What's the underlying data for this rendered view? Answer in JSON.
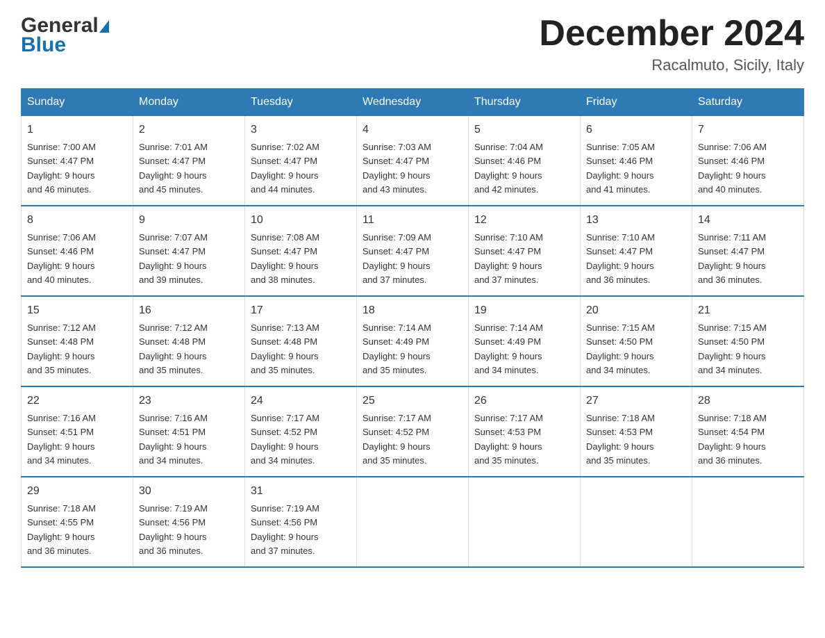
{
  "logo": {
    "line1": "General",
    "line2": "Blue"
  },
  "title": "December 2024",
  "subtitle": "Racalmuto, Sicily, Italy",
  "days_header": [
    "Sunday",
    "Monday",
    "Tuesday",
    "Wednesday",
    "Thursday",
    "Friday",
    "Saturday"
  ],
  "weeks": [
    [
      {
        "day": "1",
        "sunrise": "Sunrise: 7:00 AM",
        "sunset": "Sunset: 4:47 PM",
        "daylight": "Daylight: 9 hours",
        "daylight2": "and 46 minutes."
      },
      {
        "day": "2",
        "sunrise": "Sunrise: 7:01 AM",
        "sunset": "Sunset: 4:47 PM",
        "daylight": "Daylight: 9 hours",
        "daylight2": "and 45 minutes."
      },
      {
        "day": "3",
        "sunrise": "Sunrise: 7:02 AM",
        "sunset": "Sunset: 4:47 PM",
        "daylight": "Daylight: 9 hours",
        "daylight2": "and 44 minutes."
      },
      {
        "day": "4",
        "sunrise": "Sunrise: 7:03 AM",
        "sunset": "Sunset: 4:47 PM",
        "daylight": "Daylight: 9 hours",
        "daylight2": "and 43 minutes."
      },
      {
        "day": "5",
        "sunrise": "Sunrise: 7:04 AM",
        "sunset": "Sunset: 4:46 PM",
        "daylight": "Daylight: 9 hours",
        "daylight2": "and 42 minutes."
      },
      {
        "day": "6",
        "sunrise": "Sunrise: 7:05 AM",
        "sunset": "Sunset: 4:46 PM",
        "daylight": "Daylight: 9 hours",
        "daylight2": "and 41 minutes."
      },
      {
        "day": "7",
        "sunrise": "Sunrise: 7:06 AM",
        "sunset": "Sunset: 4:46 PM",
        "daylight": "Daylight: 9 hours",
        "daylight2": "and 40 minutes."
      }
    ],
    [
      {
        "day": "8",
        "sunrise": "Sunrise: 7:06 AM",
        "sunset": "Sunset: 4:46 PM",
        "daylight": "Daylight: 9 hours",
        "daylight2": "and 40 minutes."
      },
      {
        "day": "9",
        "sunrise": "Sunrise: 7:07 AM",
        "sunset": "Sunset: 4:47 PM",
        "daylight": "Daylight: 9 hours",
        "daylight2": "and 39 minutes."
      },
      {
        "day": "10",
        "sunrise": "Sunrise: 7:08 AM",
        "sunset": "Sunset: 4:47 PM",
        "daylight": "Daylight: 9 hours",
        "daylight2": "and 38 minutes."
      },
      {
        "day": "11",
        "sunrise": "Sunrise: 7:09 AM",
        "sunset": "Sunset: 4:47 PM",
        "daylight": "Daylight: 9 hours",
        "daylight2": "and 37 minutes."
      },
      {
        "day": "12",
        "sunrise": "Sunrise: 7:10 AM",
        "sunset": "Sunset: 4:47 PM",
        "daylight": "Daylight: 9 hours",
        "daylight2": "and 37 minutes."
      },
      {
        "day": "13",
        "sunrise": "Sunrise: 7:10 AM",
        "sunset": "Sunset: 4:47 PM",
        "daylight": "Daylight: 9 hours",
        "daylight2": "and 36 minutes."
      },
      {
        "day": "14",
        "sunrise": "Sunrise: 7:11 AM",
        "sunset": "Sunset: 4:47 PM",
        "daylight": "Daylight: 9 hours",
        "daylight2": "and 36 minutes."
      }
    ],
    [
      {
        "day": "15",
        "sunrise": "Sunrise: 7:12 AM",
        "sunset": "Sunset: 4:48 PM",
        "daylight": "Daylight: 9 hours",
        "daylight2": "and 35 minutes."
      },
      {
        "day": "16",
        "sunrise": "Sunrise: 7:12 AM",
        "sunset": "Sunset: 4:48 PM",
        "daylight": "Daylight: 9 hours",
        "daylight2": "and 35 minutes."
      },
      {
        "day": "17",
        "sunrise": "Sunrise: 7:13 AM",
        "sunset": "Sunset: 4:48 PM",
        "daylight": "Daylight: 9 hours",
        "daylight2": "and 35 minutes."
      },
      {
        "day": "18",
        "sunrise": "Sunrise: 7:14 AM",
        "sunset": "Sunset: 4:49 PM",
        "daylight": "Daylight: 9 hours",
        "daylight2": "and 35 minutes."
      },
      {
        "day": "19",
        "sunrise": "Sunrise: 7:14 AM",
        "sunset": "Sunset: 4:49 PM",
        "daylight": "Daylight: 9 hours",
        "daylight2": "and 34 minutes."
      },
      {
        "day": "20",
        "sunrise": "Sunrise: 7:15 AM",
        "sunset": "Sunset: 4:50 PM",
        "daylight": "Daylight: 9 hours",
        "daylight2": "and 34 minutes."
      },
      {
        "day": "21",
        "sunrise": "Sunrise: 7:15 AM",
        "sunset": "Sunset: 4:50 PM",
        "daylight": "Daylight: 9 hours",
        "daylight2": "and 34 minutes."
      }
    ],
    [
      {
        "day": "22",
        "sunrise": "Sunrise: 7:16 AM",
        "sunset": "Sunset: 4:51 PM",
        "daylight": "Daylight: 9 hours",
        "daylight2": "and 34 minutes."
      },
      {
        "day": "23",
        "sunrise": "Sunrise: 7:16 AM",
        "sunset": "Sunset: 4:51 PM",
        "daylight": "Daylight: 9 hours",
        "daylight2": "and 34 minutes."
      },
      {
        "day": "24",
        "sunrise": "Sunrise: 7:17 AM",
        "sunset": "Sunset: 4:52 PM",
        "daylight": "Daylight: 9 hours",
        "daylight2": "and 34 minutes."
      },
      {
        "day": "25",
        "sunrise": "Sunrise: 7:17 AM",
        "sunset": "Sunset: 4:52 PM",
        "daylight": "Daylight: 9 hours",
        "daylight2": "and 35 minutes."
      },
      {
        "day": "26",
        "sunrise": "Sunrise: 7:17 AM",
        "sunset": "Sunset: 4:53 PM",
        "daylight": "Daylight: 9 hours",
        "daylight2": "and 35 minutes."
      },
      {
        "day": "27",
        "sunrise": "Sunrise: 7:18 AM",
        "sunset": "Sunset: 4:53 PM",
        "daylight": "Daylight: 9 hours",
        "daylight2": "and 35 minutes."
      },
      {
        "day": "28",
        "sunrise": "Sunrise: 7:18 AM",
        "sunset": "Sunset: 4:54 PM",
        "daylight": "Daylight: 9 hours",
        "daylight2": "and 36 minutes."
      }
    ],
    [
      {
        "day": "29",
        "sunrise": "Sunrise: 7:18 AM",
        "sunset": "Sunset: 4:55 PM",
        "daylight": "Daylight: 9 hours",
        "daylight2": "and 36 minutes."
      },
      {
        "day": "30",
        "sunrise": "Sunrise: 7:19 AM",
        "sunset": "Sunset: 4:56 PM",
        "daylight": "Daylight: 9 hours",
        "daylight2": "and 36 minutes."
      },
      {
        "day": "31",
        "sunrise": "Sunrise: 7:19 AM",
        "sunset": "Sunset: 4:56 PM",
        "daylight": "Daylight: 9 hours",
        "daylight2": "and 37 minutes."
      },
      null,
      null,
      null,
      null
    ]
  ]
}
